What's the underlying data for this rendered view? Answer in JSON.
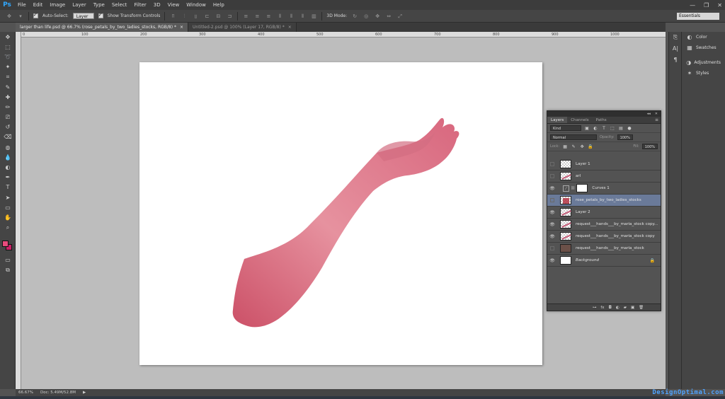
{
  "app": {
    "logo": "Ps"
  },
  "menu": [
    "File",
    "Edit",
    "Image",
    "Layer",
    "Type",
    "Select",
    "Filter",
    "3D",
    "View",
    "Window",
    "Help"
  ],
  "window_controls": {
    "minimize": "—",
    "restore": "❐",
    "close": "✕"
  },
  "options_bar": {
    "auto_select_label": "Auto-Select:",
    "auto_select_value": "Layer",
    "transform_label": "Show Transform Controls",
    "mode_3d_label": "3D Mode:",
    "workspace": "Essentials"
  },
  "doc_tabs": [
    {
      "label": "larger than life.psd @ 66.7% (rose_petals_by_two_ladies_stocks, RGB/8) *",
      "close": "×",
      "active": true
    },
    {
      "label": "Untitled-2.psd @ 100% (Layer 17, RGB/8) *",
      "close": "×",
      "active": false
    }
  ],
  "ruler_labels": [
    "0",
    "100",
    "200",
    "300",
    "400",
    "500",
    "600",
    "700",
    "800",
    "900",
    "1000",
    "1100"
  ],
  "status": {
    "zoom": "66.67%",
    "doc": "Doc: 5.49M/52.8M",
    "arrow": "▶"
  },
  "tools": [
    "move-tool",
    "marquee-tool",
    "lasso-tool",
    "quick-select-tool",
    "crop-tool",
    "eyedropper-tool",
    "healing-tool",
    "brush-tool",
    "clone-stamp-tool",
    "history-brush-tool",
    "eraser-tool",
    "paint-bucket-tool",
    "blur-tool",
    "dodge-tool",
    "pen-tool",
    "type-tool",
    "path-select-tool",
    "shape-tool",
    "hand-tool",
    "zoom-tool"
  ],
  "tool_glyphs": [
    "✥",
    "⬚",
    "➰",
    "✦",
    "⌗",
    "✎",
    "✚",
    "✏",
    "⎚",
    "↺",
    "⌫",
    "◍",
    "💧",
    "◐",
    "✒",
    "T",
    "➤",
    "▭",
    "✋",
    "⌕"
  ],
  "swatches": {
    "foreground": "#e84b7d",
    "background": "#c81f65"
  },
  "dock_panels": [
    {
      "label": "Color",
      "icon": "color-icon",
      "glyph": "◐"
    },
    {
      "label": "Swatches",
      "icon": "swatches-icon",
      "glyph": "▦"
    },
    {
      "label": "Adjustments",
      "icon": "adjustments-icon",
      "glyph": "◑"
    },
    {
      "label": "Styles",
      "icon": "styles-icon",
      "glyph": "✶"
    }
  ],
  "layers_panel": {
    "tabs": [
      "Layers",
      "Channels",
      "Paths"
    ],
    "filter_kind": "Kind",
    "blend_mode": "Normal",
    "opacity_label": "Opacity:",
    "opacity_value": "100%",
    "lock_label": "Lock:",
    "fill_label": "Fill:",
    "fill_value": "100%",
    "layers": [
      {
        "name": "Layer 1",
        "visible": false,
        "thumb": "checker"
      },
      {
        "name": "arl",
        "visible": false,
        "thumb": "checker-red"
      },
      {
        "name": "Curves 1",
        "visible": true,
        "thumb": "adjustment"
      },
      {
        "name": "rose_petals_by_two_ladies_stocks",
        "visible": false,
        "thumb": "red",
        "selected": true
      },
      {
        "name": "Layer 2",
        "visible": true,
        "thumb": "checker-arm"
      },
      {
        "name": "request___hands___by_maria_stock copy...",
        "visible": true,
        "thumb": "checker-arm"
      },
      {
        "name": "request___hands___by_maria_stock copy",
        "visible": true,
        "thumb": "checker-arm"
      },
      {
        "name": "request___hands___by_maria_stock",
        "visible": false,
        "thumb": "dark"
      },
      {
        "name": "Background",
        "visible": true,
        "thumb": "white",
        "locked": true
      }
    ],
    "footer_icons": [
      "⊶",
      "fx",
      "◘",
      "◐",
      "▰",
      "▣",
      "🗑"
    ]
  },
  "watermark": "DesignOptimal.com"
}
